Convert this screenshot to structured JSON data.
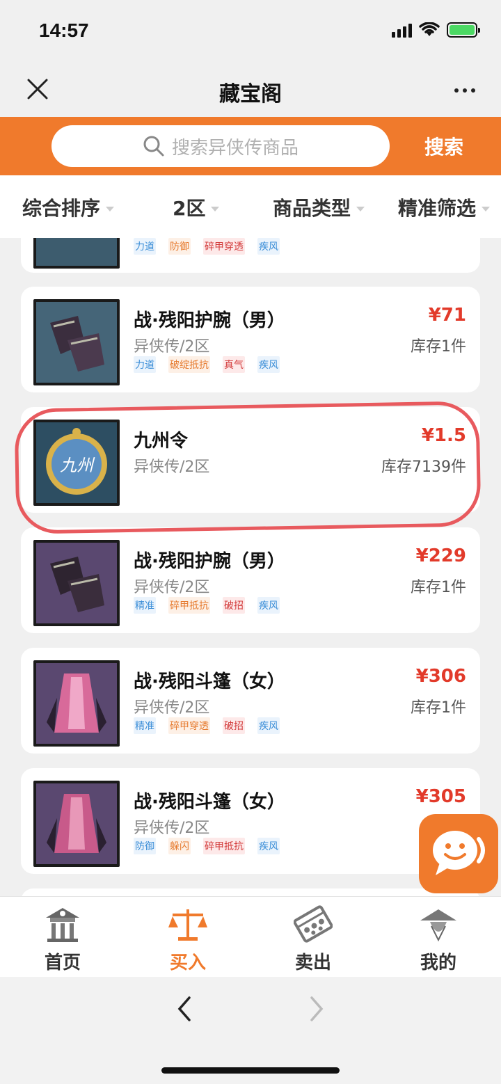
{
  "status": {
    "time": "14:57"
  },
  "header": {
    "title": "藏宝阁"
  },
  "search": {
    "placeholder": "搜索异侠传商品",
    "button_label": "搜索"
  },
  "filters": [
    "综合排序",
    "2区",
    "商品类型",
    "精准筛选"
  ],
  "partial_item": {
    "tags": [
      "力道",
      "防御",
      "碎甲穿透",
      "疾风"
    ]
  },
  "items": [
    {
      "name": "战·残阳护腕（男）",
      "server": "异侠传/2区",
      "price": "¥71",
      "stock": "库存1件",
      "tags": [
        "力道",
        "破绽抵抗",
        "真气",
        "疾风"
      ]
    },
    {
      "name": "九州令",
      "server": "异侠传/2区",
      "price": "¥1.5",
      "stock": "库存7139件",
      "tags": []
    },
    {
      "name": "战·残阳护腕（男）",
      "server": "异侠传/2区",
      "price": "¥229",
      "stock": "库存1件",
      "tags": [
        "精准",
        "碎甲抵抗",
        "破招",
        "疾风"
      ]
    },
    {
      "name": "战·残阳斗篷（女）",
      "server": "异侠传/2区",
      "price": "¥306",
      "stock": "库存1件",
      "tags": [
        "精准",
        "碎甲穿透",
        "破招",
        "疾风"
      ]
    },
    {
      "name": "战·残阳斗篷（女）",
      "server": "异侠传/2区",
      "price": "¥305",
      "stock": "库",
      "tags": [
        "防御",
        "躲闪",
        "碎甲抵抗",
        "疾风"
      ]
    }
  ],
  "jiuzhou_badge_text": "九州",
  "tabs": [
    {
      "label": "首页",
      "icon": "pavilion-icon",
      "active": false
    },
    {
      "label": "买入",
      "icon": "scale-icon",
      "active": true
    },
    {
      "label": "卖出",
      "icon": "abacus-icon",
      "active": false
    },
    {
      "label": "我的",
      "icon": "straw-hat-icon",
      "active": false
    }
  ],
  "colors": {
    "accent": "#f07a2c",
    "price": "#e23a2a",
    "highlight": "#e85a5e"
  }
}
